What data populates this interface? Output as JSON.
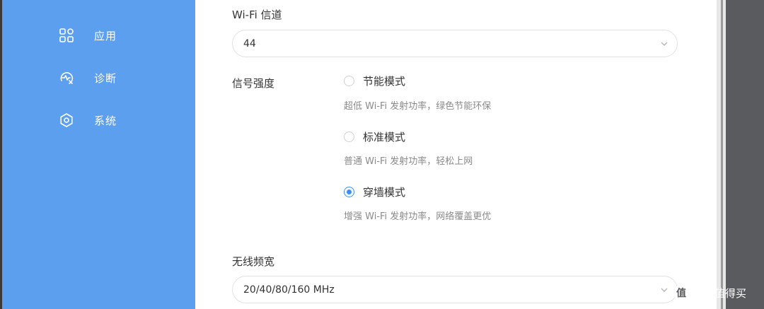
{
  "sidebar": {
    "items": [
      {
        "label": "应用",
        "icon": "apps-grid-icon"
      },
      {
        "label": "诊断",
        "icon": "diagnose-icon"
      },
      {
        "label": "系统",
        "icon": "gear-icon"
      }
    ]
  },
  "wifi_channel": {
    "label": "Wi-Fi 信道",
    "value": "44"
  },
  "signal_strength": {
    "label": "信号强度",
    "options": [
      {
        "label": "节能模式",
        "desc": "超低 Wi-Fi 发射功率，绿色节能环保",
        "checked": false
      },
      {
        "label": "标准模式",
        "desc": "普通 Wi-Fi 发射功率，轻松上网",
        "checked": false
      },
      {
        "label": "穿墙模式",
        "desc": "增强 Wi-Fi 发射功率，网络覆盖更优",
        "checked": true
      }
    ]
  },
  "bandwidth": {
    "label": "无线频宽",
    "value": "20/40/80/160 MHz"
  },
  "watermark": {
    "logo_char": "值",
    "text": "什么值得买"
  },
  "colors": {
    "sidebar_bg": "#5c9fef",
    "accent": "#3d8ff0",
    "right_panel": "#5a5b5e"
  }
}
